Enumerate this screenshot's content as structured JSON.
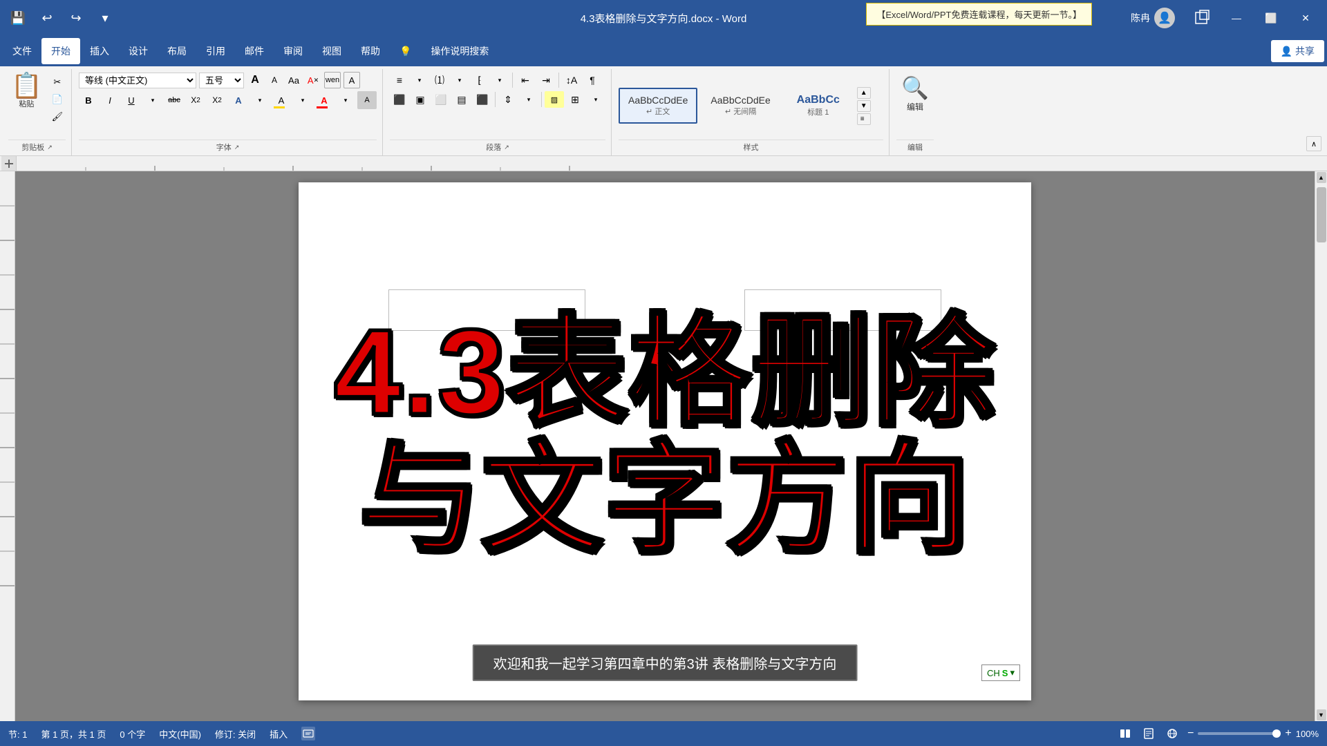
{
  "titleBar": {
    "title": "4.3表格删除与文字方向.docx - Word",
    "appName": "Word",
    "saveIcon": "💾",
    "undoIcon": "↩",
    "redoIcon": "↪",
    "customizeIcon": "▾",
    "userName": "陈冉",
    "minimizeLabel": "—",
    "restoreLabel": "🗗",
    "closeLabel": "✕",
    "notification": "【Excel/Word/PPT免费连载课程，每天更新一节。】"
  },
  "menuBar": {
    "items": [
      "文件",
      "开始",
      "插入",
      "设计",
      "布局",
      "引用",
      "邮件",
      "审阅",
      "视图",
      "帮助",
      "💡",
      "操作说明搜索"
    ],
    "activeItem": "开始",
    "shareLabel": "共享",
    "shareIcon": "👤"
  },
  "ribbon": {
    "clipboard": {
      "label": "剪贴板",
      "pasteLabel": "粘贴",
      "cutLabel": "✂",
      "copyLabel": "📋",
      "formatPaintLabel": "🖌"
    },
    "font": {
      "label": "字体",
      "fontName": "等线 (中文正文)",
      "fontSize": "五号",
      "growLabel": "A",
      "shrinkLabel": "A",
      "fontAaLabel": "Aa",
      "clearLabel": "A",
      "pinLabel": "wen",
      "boldLabel": "B",
      "italicLabel": "I",
      "underlineLabel": "U",
      "strikeLabel": "abc",
      "subLabel": "X₂",
      "superLabel": "X²",
      "fontColorLabel": "A",
      "highlightLabel": "A",
      "charSpacingLabel": "A"
    },
    "paragraph": {
      "label": "段落"
    },
    "styles": {
      "label": "样式",
      "items": [
        {
          "name": "AaBbCcDdEe",
          "label": "正文",
          "active": true
        },
        {
          "name": "AaBbCcDdEe",
          "label": "无间隔"
        },
        {
          "name": "AaBbCc",
          "label": "标题 1"
        }
      ]
    },
    "editing": {
      "label": "编辑"
    }
  },
  "document": {
    "titleLine1": "4.3表格删除",
    "titleLine2": "与文字方向",
    "textColor": "#cc0000"
  },
  "subtitleBar": {
    "text": "欢迎和我一起学习第四章中的第3讲 表格删除与文字方向"
  },
  "statusBar": {
    "section": "节: 1",
    "page": "第 1 页，共 1 页",
    "wordCount": "0 个字",
    "language": "中文(中国)",
    "trackChanges": "修订: 关闭",
    "insertMode": "插入",
    "imeIndicator": "CH S",
    "zoomLevel": "100%"
  }
}
